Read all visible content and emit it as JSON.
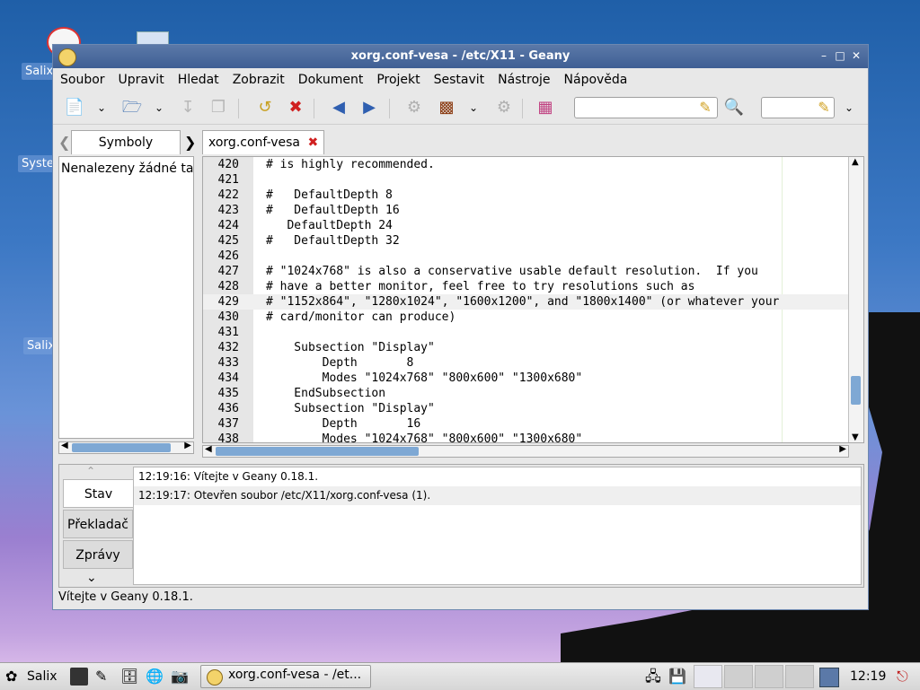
{
  "desktop": {
    "labels": [
      "Salix",
      "Syste",
      "Salix"
    ]
  },
  "window": {
    "title": "xorg.conf-vesa - /etc/X11 - Geany",
    "menu": [
      "Soubor",
      "Upravit",
      "Hledat",
      "Zobrazit",
      "Dokument",
      "Projekt",
      "Sestavit",
      "Nástroje",
      "Nápověda"
    ]
  },
  "toolbar": {
    "search_value": "",
    "goto_value": ""
  },
  "sidebar": {
    "tab_label": "Symboly",
    "empty_text": "Nenalezeny žádné tagy"
  },
  "editor": {
    "tab_label": "xorg.conf-vesa",
    "current_line": 429,
    "lines": [
      {
        "n": "420",
        "t": "# is highly recommended."
      },
      {
        "n": "421",
        "t": ""
      },
      {
        "n": "422",
        "t": "#   DefaultDepth 8"
      },
      {
        "n": "423",
        "t": "#   DefaultDepth 16"
      },
      {
        "n": "424",
        "t": "   DefaultDepth 24"
      },
      {
        "n": "425",
        "t": "#   DefaultDepth 32"
      },
      {
        "n": "426",
        "t": ""
      },
      {
        "n": "427",
        "t": "# \"1024x768\" is also a conservative usable default resolution.  If you"
      },
      {
        "n": "428",
        "t": "# have a better monitor, feel free to try resolutions such as"
      },
      {
        "n": "429",
        "t": "# \"1152x864\", \"1280x1024\", \"1600x1200\", and \"1800x1400\" (or whatever your"
      },
      {
        "n": "430",
        "t": "# card/monitor can produce)"
      },
      {
        "n": "431",
        "t": ""
      },
      {
        "n": "432",
        "t": "    Subsection \"Display\""
      },
      {
        "n": "433",
        "t": "        Depth       8"
      },
      {
        "n": "434",
        "t": "        Modes \"1024x768\" \"800x600\" \"1300x680\""
      },
      {
        "n": "435",
        "t": "    EndSubsection"
      },
      {
        "n": "436",
        "t": "    Subsection \"Display\""
      },
      {
        "n": "437",
        "t": "        Depth       16"
      },
      {
        "n": "438",
        "t": "        Modes \"1024x768\" \"800x600\" \"1300x680\""
      }
    ]
  },
  "bottom_panel": {
    "tabs": [
      "Stav",
      "Překladač",
      "Zprávy"
    ],
    "active_tab": "Stav",
    "messages": [
      "12:19:16: Vítejte v Geany 0.18.1.",
      "12:19:17: Otevřen soubor /etc/X11/xorg.conf-vesa (1)."
    ]
  },
  "statusbar": {
    "text": "Vítejte v Geany 0.18.1."
  },
  "taskbar": {
    "start_label": "Salix",
    "task_label": "xorg.conf-vesa - /et...",
    "clock": "12:19"
  }
}
